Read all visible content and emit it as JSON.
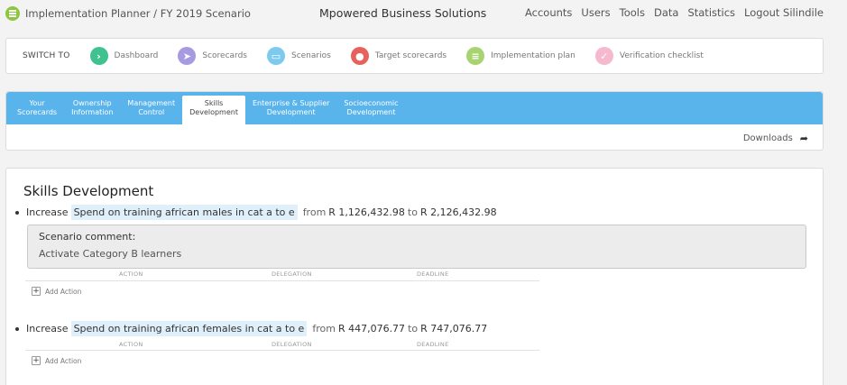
{
  "header": {
    "breadcrumb": "Implementation Planner / FY 2019 Scenario",
    "brand": "Mpowered Business Solutions",
    "nav": [
      "Accounts",
      "Users",
      "Tools",
      "Data",
      "Statistics",
      "Logout Silindile"
    ]
  },
  "switch_bar": {
    "label": "SWITCH TO",
    "items": [
      {
        "label": "Dashboard",
        "color": "#3fc28f"
      },
      {
        "label": "Scorecards",
        "color": "#a79ae0"
      },
      {
        "label": "Scenarios",
        "color": "#7ccbee"
      },
      {
        "label": "Target scorecards",
        "color": "#e8625d"
      },
      {
        "label": "Implementation plan",
        "color": "#a7d470"
      },
      {
        "label": "Verification checklist",
        "color": "#f5b8cf"
      }
    ]
  },
  "tabs": [
    {
      "line1": "Your",
      "line2": "Scorecards"
    },
    {
      "line1": "Ownership",
      "line2": "Information"
    },
    {
      "line1": "Management",
      "line2": "Control"
    },
    {
      "line1": "Skills",
      "line2": "Development"
    },
    {
      "line1": "Enterprise & Supplier",
      "line2": "Development"
    },
    {
      "line1": "Socioeconomic",
      "line2": "Development"
    }
  ],
  "downloads_label": "Downloads",
  "section": {
    "title": "Skills Development",
    "items": [
      {
        "verb": "Increase",
        "metric": "Spend on training african males in cat a to e",
        "from_word": "from",
        "from_value": "R 1,126,432.98",
        "to_word": "to",
        "to_value": "R 2,126,432.98",
        "comment_title": "Scenario comment:",
        "comment_text": "Activate Category B learners"
      },
      {
        "verb": "Increase",
        "metric": "Spend on training african females in cat a to e",
        "from_word": "from",
        "from_value": "R 447,076.77",
        "to_word": "to",
        "to_value": "R 747,076.77"
      }
    ],
    "columns": [
      "ACTION",
      "DELEGATION",
      "DEADLINE"
    ],
    "add_action": "Add Action"
  }
}
